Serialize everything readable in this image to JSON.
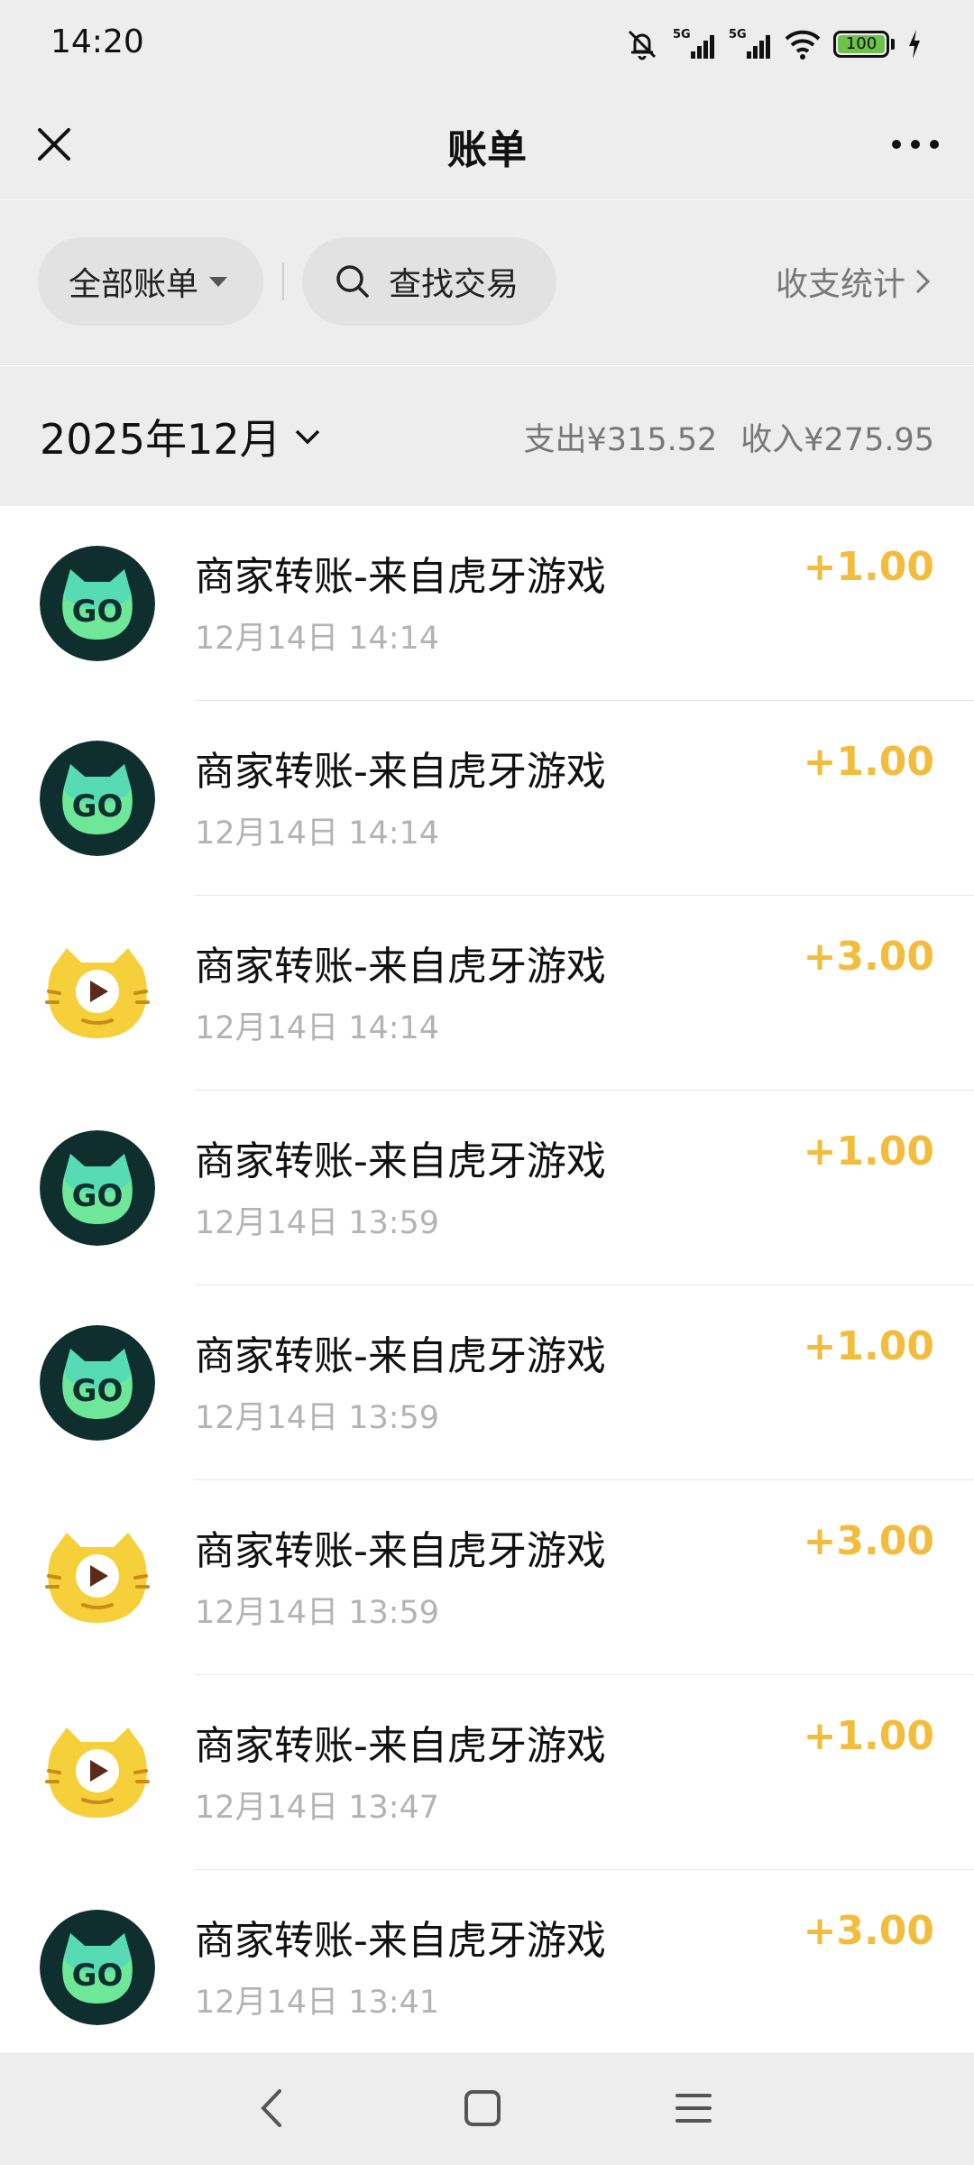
{
  "status_bar": {
    "time": "14:20",
    "icons": [
      "bell-off-icon",
      "signal-5g-icon",
      "signal-5g-icon",
      "wifi-icon",
      "battery-icon",
      "charging-icon"
    ],
    "signal_label_1": "5G",
    "signal_label_2": "5G",
    "battery_level": "100"
  },
  "nav": {
    "title": "账单",
    "close_icon": "close-icon",
    "more_icon": "more-icon"
  },
  "filters": {
    "all_bills_label": "全部账单",
    "search_label": "查找交易",
    "stats_label": "收支统计"
  },
  "month": {
    "label": "2025年12月",
    "expense": "支出¥315.52",
    "income": "收入¥275.95"
  },
  "colors": {
    "amount": "#f2bd3d",
    "background": "#ededed"
  },
  "transactions": [
    {
      "title": "商家转账-来自虎牙游戏",
      "time": "12月14日 14:14",
      "amount": "+1.00",
      "icon": "go-app-icon"
    },
    {
      "title": "商家转账-来自虎牙游戏",
      "time": "12月14日 14:14",
      "amount": "+1.00",
      "icon": "go-app-icon"
    },
    {
      "title": "商家转账-来自虎牙游戏",
      "time": "12月14日 14:14",
      "amount": "+3.00",
      "icon": "huya-tiger-icon"
    },
    {
      "title": "商家转账-来自虎牙游戏",
      "time": "12月14日 13:59",
      "amount": "+1.00",
      "icon": "go-app-icon"
    },
    {
      "title": "商家转账-来自虎牙游戏",
      "time": "12月14日 13:59",
      "amount": "+1.00",
      "icon": "go-app-icon"
    },
    {
      "title": "商家转账-来自虎牙游戏",
      "time": "12月14日 13:59",
      "amount": "+3.00",
      "icon": "huya-tiger-icon"
    },
    {
      "title": "商家转账-来自虎牙游戏",
      "time": "12月14日 13:47",
      "amount": "+1.00",
      "icon": "huya-tiger-icon"
    },
    {
      "title": "商家转账-来自虎牙游戏",
      "time": "12月14日 13:41",
      "amount": "+3.00",
      "icon": "go-app-icon"
    }
  ],
  "bottom_nav": {
    "icons": [
      "back-icon",
      "home-icon",
      "menu-icon"
    ]
  }
}
